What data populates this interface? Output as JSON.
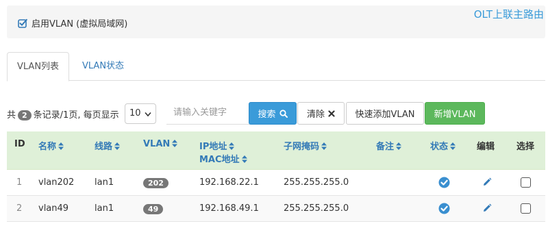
{
  "top_panel": {
    "enable_vlan_label": "启用VLAN (虚拟局域网)",
    "corner_link": "OLT上联主路由"
  },
  "tabs": [
    {
      "label": "VLAN列表",
      "active": true
    },
    {
      "label": "VLAN状态",
      "active": false
    }
  ],
  "toolbar": {
    "records_prefix": "共",
    "record_count": "2",
    "records_suffix": "条记录/1页, 每页显示",
    "page_size": "10",
    "search_placeholder": "请输入关键字",
    "search_label": "搜索",
    "clear_label": "清除",
    "quick_add_label": "快速添加VLAN",
    "new_label": "新增VLAN"
  },
  "table": {
    "headers": {
      "id": "ID",
      "name": "名称",
      "line": "线路",
      "vlan": "VLAN",
      "ip": "IP地址",
      "mac": "MAC地址",
      "mask": "子网掩码",
      "note": "备注",
      "status": "状态",
      "edit": "编辑",
      "select": "选择"
    },
    "rows": [
      {
        "id": "1",
        "name": "vlan202",
        "line": "lan1",
        "vlan": "202",
        "ip": "192.168.22.1",
        "mask": "255.255.255.0",
        "note": "",
        "status": "enabled"
      },
      {
        "id": "2",
        "name": "vlan49",
        "line": "lan1",
        "vlan": "49",
        "ip": "192.168.49.1",
        "mask": "255.255.255.0",
        "note": "",
        "status": "enabled"
      }
    ]
  },
  "colors": {
    "accent": "#3a9bd9",
    "success": "#5cb85c",
    "header_bg": "#dff0d8",
    "link": "#337ab7",
    "badge": "#777777"
  },
  "icons": {
    "enable_checkbox": "checked-square-icon",
    "search": "search-icon",
    "clear": "close-icon",
    "sort": "sort-icon",
    "status": "check-circle-icon",
    "edit": "pencil-icon",
    "select": "checkbox-icon"
  }
}
